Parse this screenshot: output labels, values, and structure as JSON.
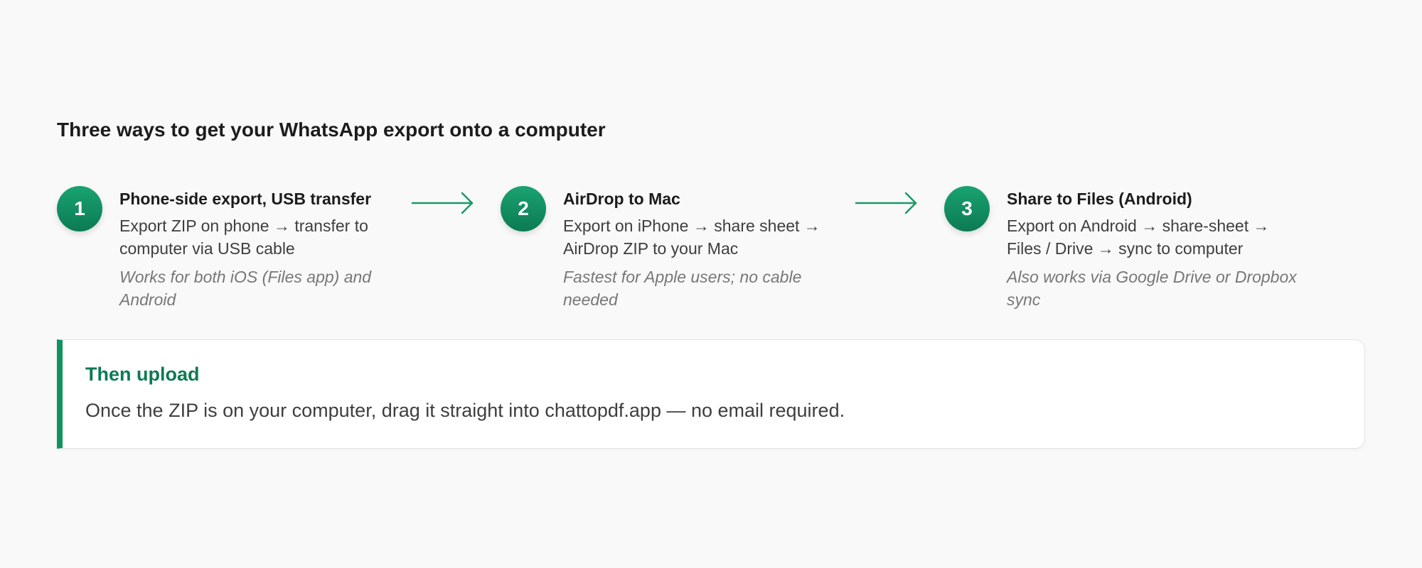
{
  "heading": "Three ways to get your WhatsApp export onto a computer",
  "steps": [
    {
      "number": "1",
      "title": "Phone-side export, USB transfer",
      "description": "Export ZIP on phone → transfer to computer via USB cable",
      "note": "Works for both iOS (Files app) and Android"
    },
    {
      "number": "2",
      "title": "AirDrop to Mac",
      "description": "Export on iPhone → share sheet → AirDrop ZIP to your Mac",
      "note": "Fastest for Apple users; no cable needed"
    },
    {
      "number": "3",
      "title": "Share to Files (Android)",
      "description": "Export on Android → share-sheet → Files / Drive → sync to computer",
      "note": "Also works via Google Drive or Dropbox sync"
    }
  ],
  "callout": {
    "title": "Then upload",
    "body": "Once the ZIP is on your computer, drag it straight into chattopdf.app — no email required."
  },
  "icons": {
    "arrow": "arrow-right-icon"
  },
  "colors": {
    "accent": "#0f9460",
    "accent_dark": "#0f7a52",
    "background": "#f9f9f9"
  }
}
